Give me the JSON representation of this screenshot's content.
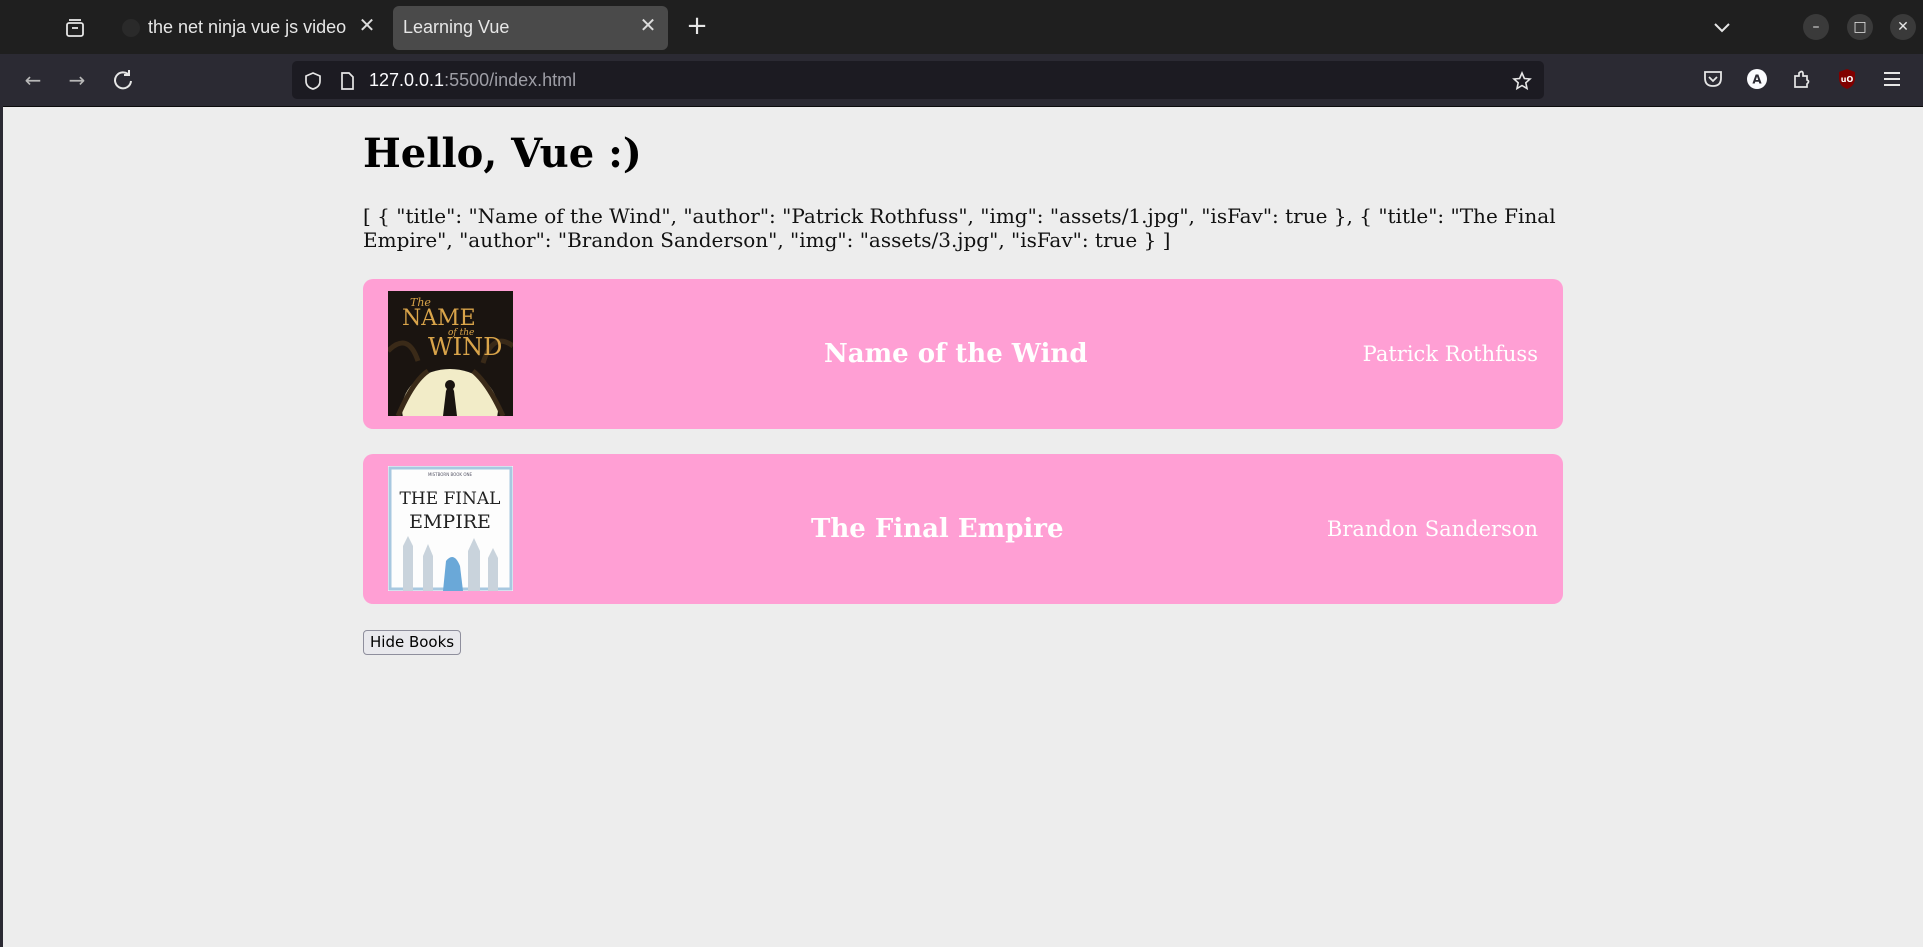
{
  "browser": {
    "tabs": [
      {
        "title": "the net ninja vue js video",
        "active": false
      },
      {
        "title": "Learning Vue",
        "active": true
      }
    ],
    "url_host": "127.0.0.1",
    "url_rest": ":5500/index.html"
  },
  "page": {
    "heading": "Hello, Vue :)",
    "books_json": "[ { \"title\": \"Name of the Wind\", \"author\": \"Patrick Rothfuss\", \"img\": \"assets/1.jpg\", \"isFav\": true }, { \"title\": \"The Final Empire\", \"author\": \"Brandon Sanderson\", \"img\": \"assets/3.jpg\", \"isFav\": true } ]",
    "books": [
      {
        "title": "Name of the Wind",
        "author": "Patrick Rothfuss",
        "cover_text": [
          "The",
          "NAME",
          "of the",
          "WIND"
        ]
      },
      {
        "title": "The Final Empire",
        "author": "Brandon Sanderson",
        "cover_text": [
          "MISTBORN BOOK ONE",
          "THE FINAL",
          "EMPIRE"
        ]
      }
    ],
    "hide_button_label": "Hide Books"
  },
  "colors": {
    "card_background": "#ff9fd4",
    "page_background": "#ededed"
  }
}
